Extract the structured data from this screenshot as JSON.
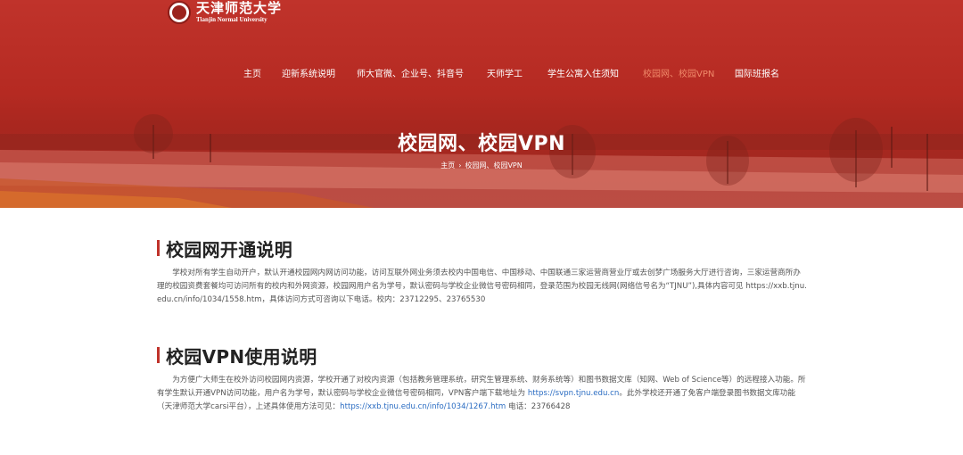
{
  "logo": {
    "cn_name": "天津师范大学",
    "en_name": "Tianjin Normal University"
  },
  "nav": {
    "items": [
      {
        "label": "主页",
        "active": false
      },
      {
        "label": "迎新系统说明",
        "active": false
      },
      {
        "label": "师大官微、企业号、抖音号",
        "active": false
      },
      {
        "label": "天师学工",
        "active": false
      },
      {
        "label": "学生公寓入住须知",
        "active": false
      },
      {
        "label": "校园网、校园VPN",
        "active": true
      },
      {
        "label": "国际班报名",
        "active": false
      }
    ]
  },
  "hero": {
    "title": "校园网、校园VPN",
    "breadcrumb": {
      "home": "主页",
      "separator": "›",
      "current": "校园网、校园VPN"
    }
  },
  "sections": [
    {
      "title": "校园网开通说明",
      "body": "学校对所有学生自动开户，默认开通校园网内网访问功能，访问互联外网业务须去校内中国电信、中国移动、中国联通三家运营商营业厅或去创梦广场服务大厅进行咨询，三家运营商所办理的校园资费套餐均可访问所有的校内和外网资源，校园网用户名为学号，默认密码与学校企业微信号密码相同，登录范围为校园无线网(网络信号名为“TJNU”),具体内容可见 https://xxb.tjnu.edu.cn/info/1034/1558.htm，具体访问方式可咨询以下电话。校内：23712295、23765530"
    },
    {
      "title": "校园VPN使用说明",
      "body_part1": "为方便广大师生在校外访问校园网内资源，学校开通了对校内资源（包括教务管理系统，研究生管理系统、财务系统等）和图书数据文库（知网、Web of Science等）的远程接入功能。所有学生默认开通VPN访问功能，用户名为学号，默认密码与学校企业微信号密码相同，VPN客户端下载地址为 ",
      "link1": "https://svpn.tjnu.edu.cn",
      "body_part2": "。此外学校还开通了免客户端登录图书数据文库功能（天津师范大学carsi平台），上述具体使用方法可见：",
      "link2": "https://xxb.tjnu.edu.cn/info/1034/1267.htm",
      "body_part3": " 电话：23766428"
    }
  ],
  "colors": {
    "brand_red": "#c0332b",
    "nav_active": "#f08a6a",
    "link": "#2a6cc2"
  }
}
